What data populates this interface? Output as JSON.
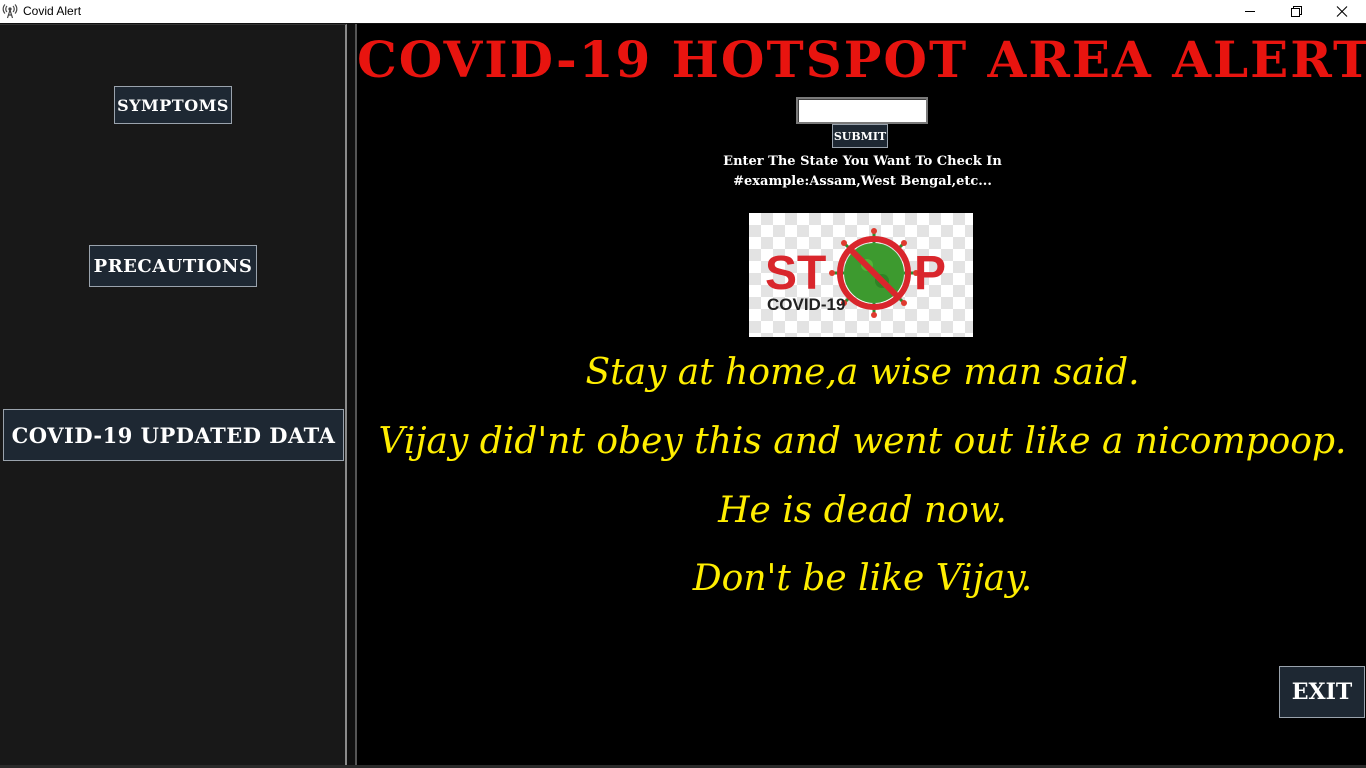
{
  "window": {
    "title": "Covid Alert",
    "icon": "antenna-icon",
    "minimize_glyph": "—",
    "maximize_glyph": "❐",
    "close_glyph": "✕"
  },
  "sidebar": {
    "buttons": [
      {
        "label": "SYMPTOMS"
      },
      {
        "label": "PRECAUTIONS"
      },
      {
        "label": "COVID-19 UPDATED DATA"
      }
    ]
  },
  "main": {
    "headline": "COVID-19 HOTSPOT AREA ALERT",
    "state_input": {
      "value": "",
      "placeholder": ""
    },
    "submit_label": "SUBMIT",
    "hint_line1": "Enter The State You Want To Check In",
    "hint_line2": "#example:Assam,West Bengal,etc...",
    "image": {
      "stop_text_left": "ST",
      "stop_text_right": "P",
      "caption": "COVID-19"
    },
    "quotes": [
      "Stay at home,a wise man said.",
      "Vijay did'nt obey this and went out like a nicompoop.",
      "He is dead now.",
      "Don't be like Vijay."
    ],
    "exit_label": "EXIT"
  },
  "colors": {
    "headline": "#e8140f",
    "quote": "#ffee00",
    "button_bg": "#1e2833",
    "panel_bg": "#000000",
    "sidebar_bg": "#181818"
  }
}
